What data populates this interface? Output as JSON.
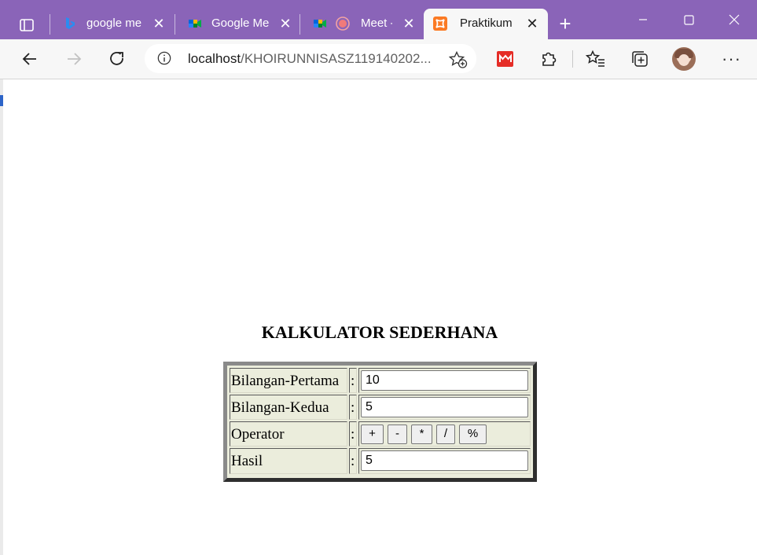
{
  "browser": {
    "tabs": [
      {
        "title": "google me",
        "icon": "bing-icon",
        "active": false
      },
      {
        "title": "Google Me",
        "icon": "google-meet-icon",
        "active": false
      },
      {
        "title": "Meet -",
        "icon": "google-meet-icon",
        "active": false
      },
      {
        "title": "Praktikum",
        "icon": "xampp-icon",
        "active": true
      }
    ],
    "url_host": "localhost",
    "url_path": "/KHOIRUNNISASZ119140202...",
    "accent": "#8a64b8"
  },
  "calculator": {
    "heading": "KALKULATOR SEDERHANA",
    "rows": [
      {
        "label": "Bilangan-Pertama",
        "separator": ":",
        "value": "10"
      },
      {
        "label": "Bilangan-Kedua",
        "separator": ":",
        "value": "5"
      },
      {
        "label": "Operator",
        "separator": ":"
      },
      {
        "label": "Hasil",
        "separator": ":",
        "value": "5"
      }
    ],
    "operators": [
      "+",
      "-",
      "*",
      "/",
      "%"
    ]
  }
}
